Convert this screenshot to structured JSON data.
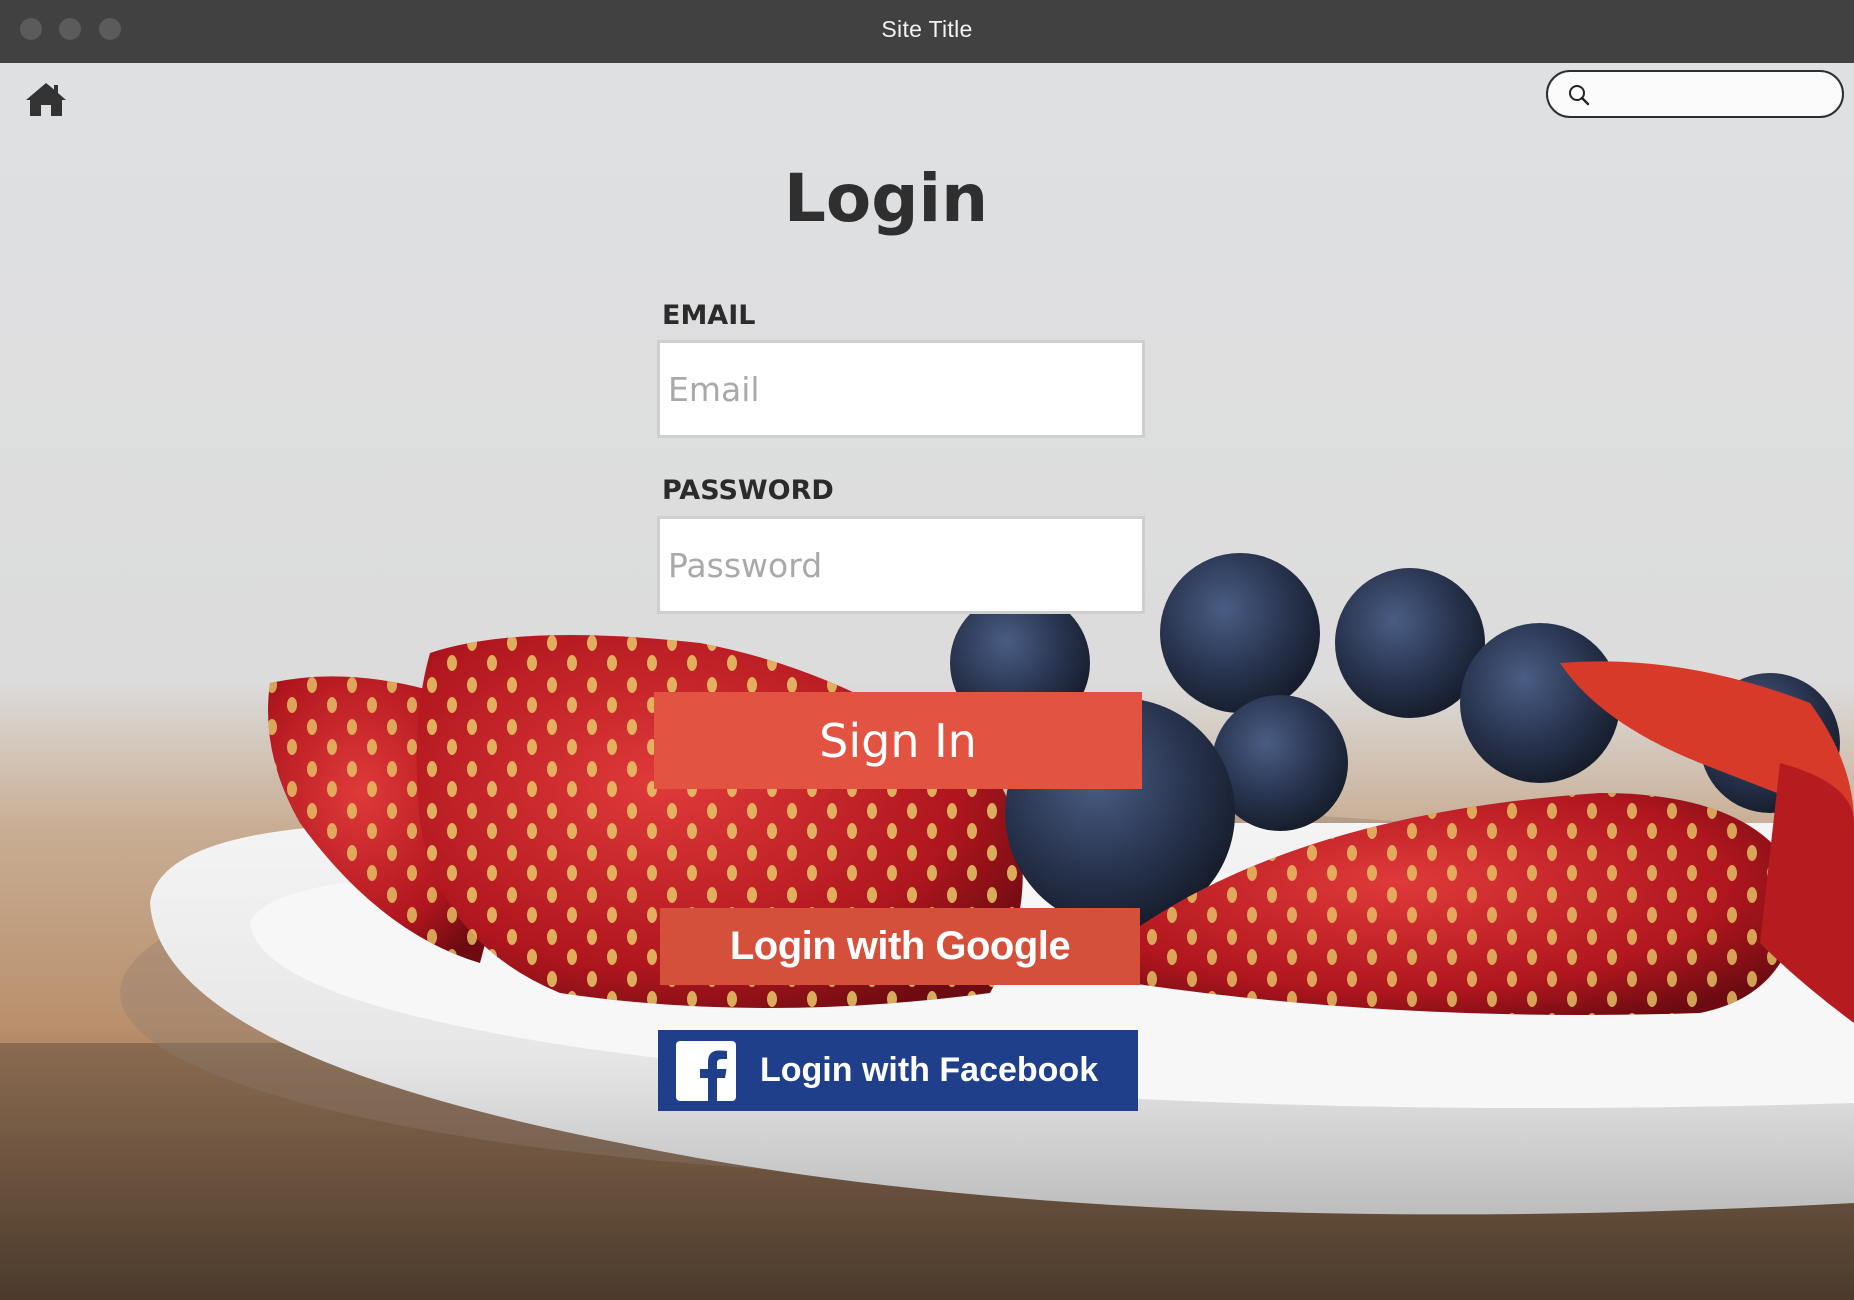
{
  "window": {
    "title": "Site Title"
  },
  "nav": {
    "home_icon": "home-icon",
    "search": {
      "icon": "search-icon",
      "value": "",
      "placeholder": ""
    }
  },
  "form": {
    "title": "Login",
    "email": {
      "label": "EMAIL",
      "placeholder": "Email",
      "value": ""
    },
    "password": {
      "label": "PASSWORD",
      "placeholder": "Password",
      "value": ""
    },
    "signin_label": "Sign In",
    "google_label": "Login with Google",
    "facebook_label": "Login with Facebook"
  },
  "colors": {
    "titlebar": "#414141",
    "signin": "#e25441",
    "google": "#d4503b",
    "facebook": "#1f3f8a"
  }
}
